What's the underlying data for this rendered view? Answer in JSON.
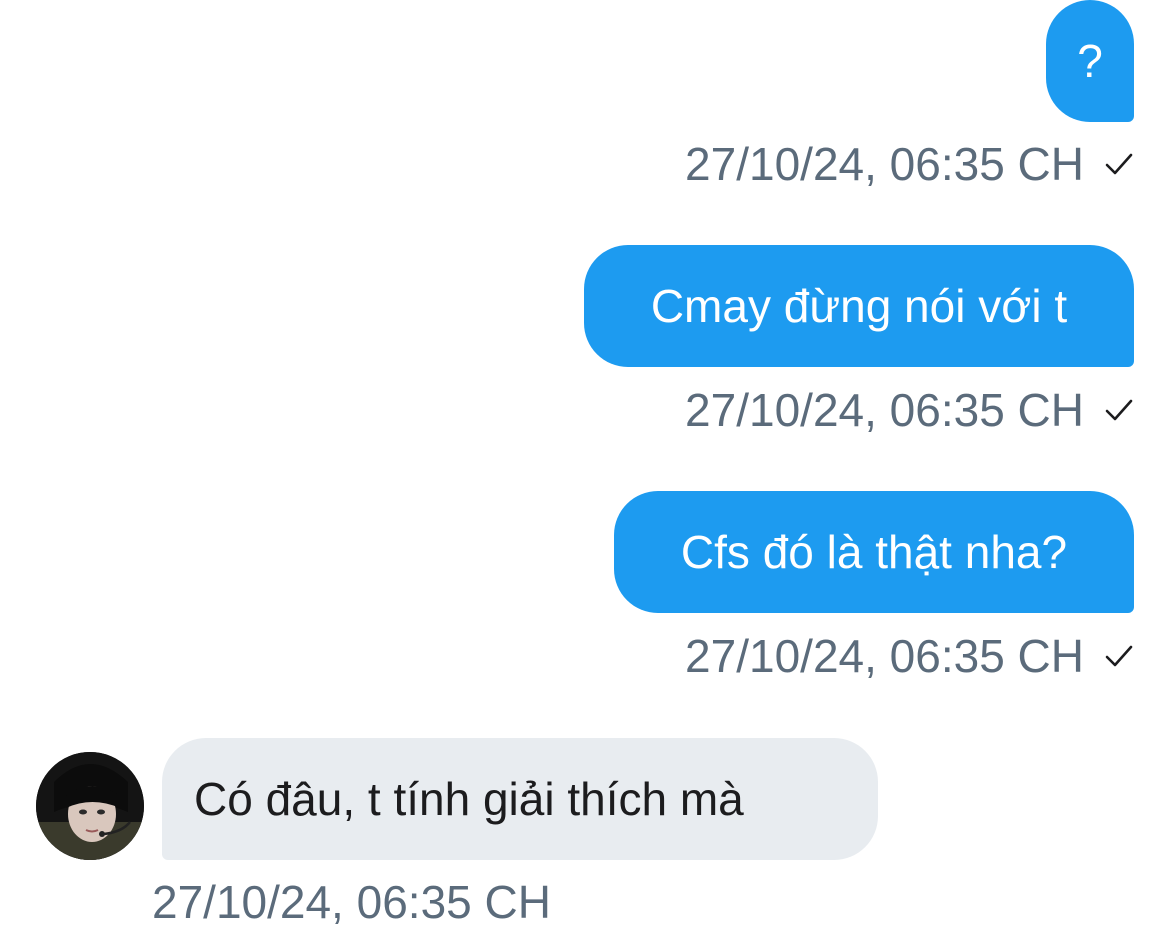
{
  "messages": [
    {
      "text": "?",
      "time": "27/10/24, 06:35 CH",
      "direction": "outgoing",
      "status": "sent"
    },
    {
      "text": "Cmay đừng nói với t",
      "time": "27/10/24, 06:35 CH",
      "direction": "outgoing",
      "status": "sent"
    },
    {
      "text": "Cfs đó là thật nha?",
      "time": "27/10/24, 06:35 CH",
      "direction": "outgoing",
      "status": "sent"
    },
    {
      "text": "Có đâu, t tính giải thích mà",
      "time": "27/10/24, 06:35 CH",
      "direction": "incoming"
    }
  ],
  "icons": {
    "status": "check-icon",
    "avatar": "avatar"
  },
  "colors": {
    "outgoing_bubble": "#1d9bf0",
    "incoming_bubble": "#e8ecf0",
    "timestamp": "#5b6b7b"
  }
}
